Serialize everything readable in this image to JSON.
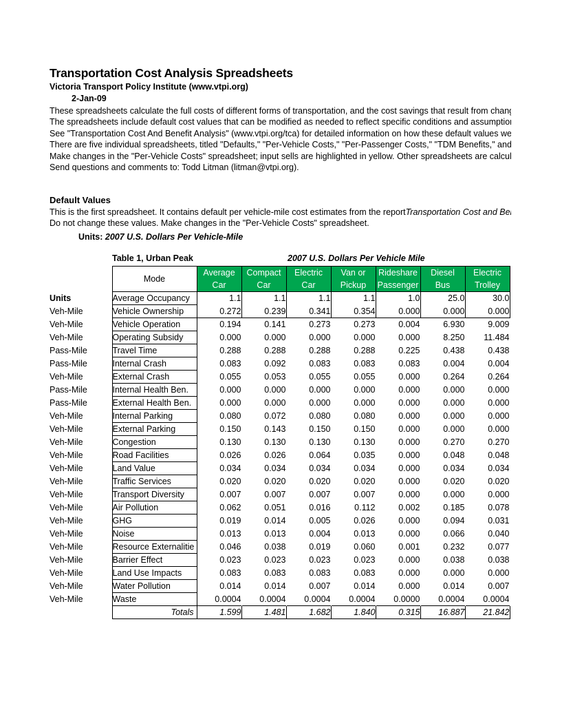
{
  "document": {
    "title": "Transportation Cost Analysis Spreadsheets",
    "institute": "Victoria Transport Policy Institute (www.vtpi.org)",
    "date": "2-Jan-09",
    "intro_lines": [
      "These spreadsheets calculate the full costs of different forms of transportation, and the cost savings that result from changes in travel activity.",
      "The spreadsheets include default cost values that can be modified as needed to reflect specific conditions and assumptions.",
      "See \"Transportation Cost And Benefit Analysis\" (www.vtpi.org/tca) for detailed information on how these default values were derived.",
      "There are five individual spreadsheets, titled \"Defaults,\" \"Per-Vehicle Costs,\" \"Per-Passenger Costs,\" \"TDM Benefits,\" and \"Summary.\"",
      "Make changes in the \"Per-Vehicle Costs\" spreadsheet; input sells are highlighted in yellow. Other spreadsheets are calculated automatically.",
      "Send questions and comments to: Todd Litman (litman@vtpi.org)."
    ]
  },
  "section": {
    "heading": "Default Values",
    "line1_prefix": "This is the first spreadsheet. It contains default per vehicle-mile cost estimates from the report",
    "line1_italic": "Transportation Cost and Benefit Analysis.",
    "line2": "Do not change these values. Make changes in the \"Per-Vehicle Costs\" spreadsheet.",
    "units_label": "Units:",
    "units_value": "2007 U.S. Dollars Per Vehicle-Mile"
  },
  "table_caption": {
    "left": "Table 1, Urban Peak",
    "right": "2007 U.S. Dollars Per Vehicle Mile"
  },
  "colors": {
    "header_green": "#00A64F",
    "header_text": "#FFFFFF",
    "grid_line": "#000000"
  },
  "chart_data": {
    "type": "table",
    "title": "Table 1, Urban Peak",
    "subtitle": "2007 U.S. Dollars Per Vehicle Mile",
    "units_column_header": "Units",
    "mode_column_header": "Mode",
    "categories": [
      "Average Car",
      "Compact Car",
      "Electric Car",
      "Van or Pickup",
      "Rideshare Passenger",
      "Diesel Bus",
      "Electric Trolley"
    ],
    "column_headers": [
      {
        "line1": "Average",
        "line2": "Car"
      },
      {
        "line1": "Compact",
        "line2": "Car"
      },
      {
        "line1": "Electric",
        "line2": "Car"
      },
      {
        "line1": "Van or",
        "line2": "Pickup"
      },
      {
        "line1": "Rideshare",
        "line2": "Passenger"
      },
      {
        "line1": "Diesel",
        "line2": "Bus"
      },
      {
        "line1": "Electric",
        "line2": "Trolley"
      }
    ],
    "rows": [
      {
        "units": "",
        "label": "Average Occupancy",
        "values": [
          "1.1",
          "1.1",
          "1.1",
          "1.1",
          "1.0",
          "25.0",
          "30.0"
        ]
      },
      {
        "units": "Veh-Mile",
        "label": "Vehicle Ownership",
        "values": [
          "0.272",
          "0.239",
          "0.341",
          "0.354",
          "0.000",
          "0.000",
          "0.000"
        ]
      },
      {
        "units": "Veh-Mile",
        "label": "Vehicle Operation",
        "values": [
          "0.194",
          "0.141",
          "0.273",
          "0.273",
          "0.004",
          "6.930",
          "9.009"
        ]
      },
      {
        "units": "Veh-Mile",
        "label": "Operating Subsidy",
        "values": [
          "0.000",
          "0.000",
          "0.000",
          "0.000",
          "0.000",
          "8.250",
          "11.484"
        ]
      },
      {
        "units": "Pass-Mile",
        "label": "Travel Time",
        "values": [
          "0.288",
          "0.288",
          "0.288",
          "0.288",
          "0.225",
          "0.438",
          "0.438"
        ]
      },
      {
        "units": "Pass-Mile",
        "label": "Internal Crash",
        "values": [
          "0.083",
          "0.092",
          "0.083",
          "0.083",
          "0.083",
          "0.004",
          "0.004"
        ]
      },
      {
        "units": "Veh-Mile",
        "label": "External Crash",
        "values": [
          "0.055",
          "0.053",
          "0.055",
          "0.055",
          "0.000",
          "0.264",
          "0.264"
        ]
      },
      {
        "units": "Pass-Mile",
        "label": "Internal Health Ben.",
        "values": [
          "0.000",
          "0.000",
          "0.000",
          "0.000",
          "0.000",
          "0.000",
          "0.000"
        ]
      },
      {
        "units": "Pass-Mile",
        "label": "External Health Ben.",
        "values": [
          "0.000",
          "0.000",
          "0.000",
          "0.000",
          "0.000",
          "0.000",
          "0.000"
        ]
      },
      {
        "units": "Veh-Mile",
        "label": "Internal Parking",
        "values": [
          "0.080",
          "0.072",
          "0.080",
          "0.080",
          "0.000",
          "0.000",
          "0.000"
        ]
      },
      {
        "units": "Veh-Mile",
        "label": "External Parking",
        "values": [
          "0.150",
          "0.143",
          "0.150",
          "0.150",
          "0.000",
          "0.000",
          "0.000"
        ]
      },
      {
        "units": "Veh-Mile",
        "label": "Congestion",
        "values": [
          "0.130",
          "0.130",
          "0.130",
          "0.130",
          "0.000",
          "0.270",
          "0.270"
        ]
      },
      {
        "units": "Veh-Mile",
        "label": "Road Facilities",
        "values": [
          "0.026",
          "0.026",
          "0.064",
          "0.035",
          "0.000",
          "0.048",
          "0.048"
        ]
      },
      {
        "units": "Veh-Mile",
        "label": "Land Value",
        "values": [
          "0.034",
          "0.034",
          "0.034",
          "0.034",
          "0.000",
          "0.034",
          "0.034"
        ]
      },
      {
        "units": "Veh-Mile",
        "label": "Traffic Services",
        "values": [
          "0.020",
          "0.020",
          "0.020",
          "0.020",
          "0.000",
          "0.020",
          "0.020"
        ]
      },
      {
        "units": "Veh-Mile",
        "label": "Transport Diversity",
        "values": [
          "0.007",
          "0.007",
          "0.007",
          "0.007",
          "0.000",
          "0.000",
          "0.000"
        ]
      },
      {
        "units": "Veh-Mile",
        "label": "Air Pollution",
        "values": [
          "0.062",
          "0.051",
          "0.016",
          "0.112",
          "0.002",
          "0.185",
          "0.078"
        ]
      },
      {
        "units": "Veh-Mile",
        "label": "GHG",
        "values": [
          "0.019",
          "0.014",
          "0.005",
          "0.026",
          "0.000",
          "0.094",
          "0.031"
        ]
      },
      {
        "units": "Veh-Mile",
        "label": "Noise",
        "values": [
          "0.013",
          "0.013",
          "0.004",
          "0.013",
          "0.000",
          "0.066",
          "0.040"
        ]
      },
      {
        "units": "Veh-Mile",
        "label": "Resource Externalitie",
        "values": [
          "0.046",
          "0.038",
          "0.019",
          "0.060",
          "0.001",
          "0.232",
          "0.077"
        ]
      },
      {
        "units": "Veh-Mile",
        "label": "Barrier Effect",
        "values": [
          "0.023",
          "0.023",
          "0.023",
          "0.023",
          "0.000",
          "0.038",
          "0.038"
        ]
      },
      {
        "units": "Veh-Mile",
        "label": "Land Use Impacts",
        "values": [
          "0.083",
          "0.083",
          "0.083",
          "0.083",
          "0.000",
          "0.000",
          "0.000"
        ]
      },
      {
        "units": "Veh-Mile",
        "label": "Water Pollution",
        "values": [
          "0.014",
          "0.014",
          "0.007",
          "0.014",
          "0.000",
          "0.014",
          "0.007"
        ]
      },
      {
        "units": "Veh-Mile",
        "label": "Waste",
        "values": [
          "0.0004",
          "0.0004",
          "0.0004",
          "0.0004",
          "0.0000",
          "0.0004",
          "0.0004"
        ]
      }
    ],
    "totals_label": "Totals",
    "totals": [
      "1.599",
      "1.481",
      "1.682",
      "1.840",
      "0.315",
      "16.887",
      "21.842"
    ]
  }
}
